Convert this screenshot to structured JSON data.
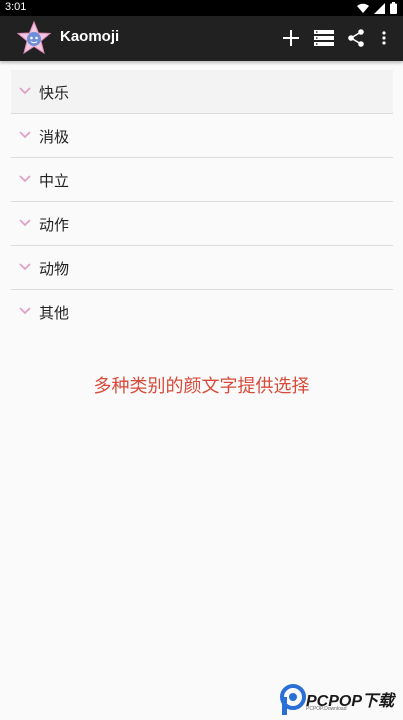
{
  "status_bar": {
    "time": "3:01",
    "icons": [
      "wifi-icon",
      "signal-icon",
      "battery-icon"
    ]
  },
  "app_bar": {
    "title": "Kaomoji",
    "actions": [
      "add-icon",
      "list-icon",
      "share-icon",
      "more-vert-icon"
    ]
  },
  "categories": [
    {
      "label": "快乐"
    },
    {
      "label": "消极"
    },
    {
      "label": "中立"
    },
    {
      "label": "动作"
    },
    {
      "label": "动物"
    },
    {
      "label": "其他"
    }
  ],
  "promo_text": "多种类别的颜文字提供选择",
  "watermark": {
    "brand": "PCPOP下载",
    "sub": "PCPOP.Download"
  },
  "colors": {
    "app_bar": "#212121",
    "chevron": "#e0a0c8",
    "promo": "#d84a3a",
    "background": "#fafafa"
  }
}
